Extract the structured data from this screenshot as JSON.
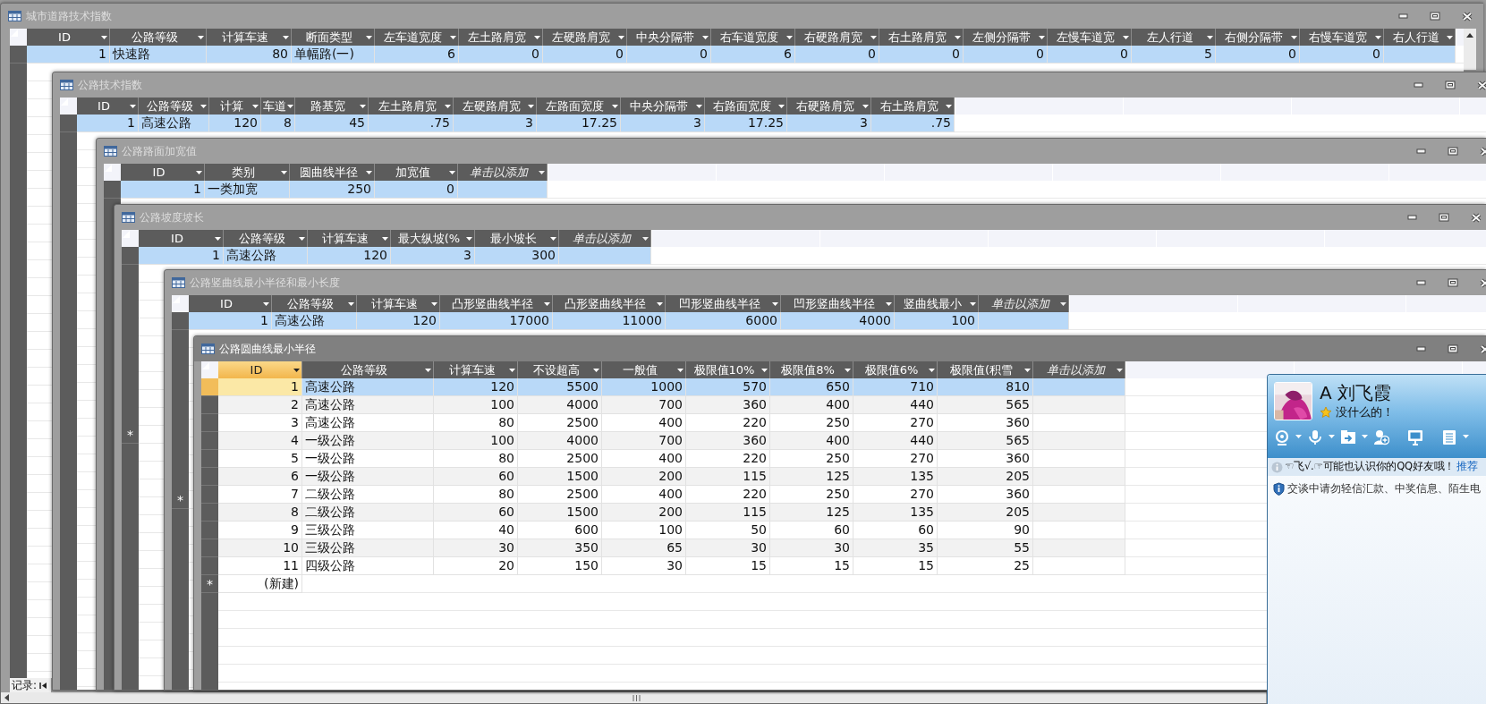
{
  "windows": [
    {
      "title": "城市道路技术指数",
      "active": false,
      "columns": [
        {
          "label": "ID",
          "kind": "number"
        },
        {
          "label": "公路等级",
          "kind": "text"
        },
        {
          "label": "计算车速",
          "kind": "number"
        },
        {
          "label": "断面类型",
          "kind": "text"
        },
        {
          "label": "左车道宽度",
          "kind": "number"
        },
        {
          "label": "左土路肩宽",
          "kind": "number"
        },
        {
          "label": "左硬路肩宽",
          "kind": "number"
        },
        {
          "label": "中央分隔带",
          "kind": "number"
        },
        {
          "label": "右车道宽度",
          "kind": "number"
        },
        {
          "label": "右硬路肩宽",
          "kind": "number"
        },
        {
          "label": "右土路肩宽",
          "kind": "number"
        },
        {
          "label": "左侧分隔带",
          "kind": "number"
        },
        {
          "label": "左慢车道宽",
          "kind": "number"
        },
        {
          "label": "左人行道",
          "kind": "number"
        },
        {
          "label": "右侧分隔带",
          "kind": "number"
        },
        {
          "label": "右慢车道宽",
          "kind": "number"
        },
        {
          "label": "右人行道",
          "kind": "number"
        }
      ],
      "rows": [
        {
          "cells": [
            "1",
            "快速路",
            "80",
            "单幅路(一)",
            "6",
            "0",
            "0",
            "0",
            "6",
            "0",
            "0",
            "0",
            "0",
            "5",
            "0",
            "0"
          ],
          "selected": true
        }
      ],
      "navigation": {
        "label": "记录:"
      }
    },
    {
      "title": "公路技术指数",
      "active": false,
      "columns": [
        {
          "label": "ID",
          "kind": "number"
        },
        {
          "label": "公路等级",
          "kind": "text"
        },
        {
          "label": "计算",
          "kind": "number"
        },
        {
          "label": "车道",
          "kind": "number"
        },
        {
          "label": "路基宽",
          "kind": "number"
        },
        {
          "label": "左土路肩宽",
          "kind": "number"
        },
        {
          "label": "左硬路肩宽",
          "kind": "number"
        },
        {
          "label": "左路面宽度",
          "kind": "number"
        },
        {
          "label": "中央分隔带",
          "kind": "number"
        },
        {
          "label": "右路面宽度",
          "kind": "number"
        },
        {
          "label": "右硬路肩宽",
          "kind": "number"
        },
        {
          "label": "右土路肩宽",
          "kind": "number"
        }
      ],
      "rows": [
        {
          "cells": [
            "1",
            "高速公路",
            "120",
            "8",
            "45",
            ".75",
            "3",
            "17.25",
            "3",
            "17.25",
            "3",
            ".75"
          ],
          "selected": true
        }
      ]
    },
    {
      "title": "公路路面加宽值",
      "active": false,
      "columns": [
        {
          "label": "ID",
          "kind": "number"
        },
        {
          "label": "类别",
          "kind": "text"
        },
        {
          "label": "圆曲线半径",
          "kind": "number"
        },
        {
          "label": "加宽值",
          "kind": "number"
        }
      ],
      "add_column": "单击以添加",
      "rows": [
        {
          "cells": [
            "1",
            "一类加宽",
            "250",
            "0"
          ],
          "selected": true
        }
      ]
    },
    {
      "title": "公路坡度坡长",
      "active": false,
      "columns": [
        {
          "label": "ID",
          "kind": "number"
        },
        {
          "label": "公路等级",
          "kind": "text"
        },
        {
          "label": "计算车速",
          "kind": "number"
        },
        {
          "label": "最大纵坡(%",
          "kind": "number"
        },
        {
          "label": "最小坡长",
          "kind": "number"
        }
      ],
      "add_column": "单击以添加",
      "rows": [
        {
          "cells": [
            "1",
            "高速公路",
            "120",
            "3",
            "300"
          ],
          "selected": true
        }
      ],
      "new_row": {
        "marker": "*"
      }
    },
    {
      "title": "公路竖曲线最小半径和最小长度",
      "active": false,
      "columns": [
        {
          "label": "ID",
          "kind": "number"
        },
        {
          "label": "公路等级",
          "kind": "text"
        },
        {
          "label": "计算车速",
          "kind": "number"
        },
        {
          "label": "凸形竖曲线半径",
          "kind": "number"
        },
        {
          "label": "凸形竖曲线半径",
          "kind": "number"
        },
        {
          "label": "凹形竖曲线半径",
          "kind": "number"
        },
        {
          "label": "凹形竖曲线半径",
          "kind": "number"
        },
        {
          "label": "竖曲线最小",
          "kind": "number"
        }
      ],
      "add_column": "单击以添加",
      "rows": [
        {
          "cells": [
            "1",
            "高速公路",
            "120",
            "17000",
            "11000",
            "6000",
            "4000",
            "100"
          ],
          "selected": true
        }
      ],
      "new_row": {
        "marker": "*"
      }
    },
    {
      "title": "公路圆曲线最小半径",
      "active": true,
      "columns": [
        {
          "label": "ID",
          "kind": "number",
          "selected": true
        },
        {
          "label": "公路等级",
          "kind": "text",
          "selected": false
        },
        {
          "label": "计算车速",
          "kind": "number",
          "selected": false
        },
        {
          "label": "不设超高",
          "kind": "number",
          "selected": false
        },
        {
          "label": "一般值",
          "kind": "number",
          "selected": false
        },
        {
          "label": "极限值10%",
          "kind": "number",
          "selected": false
        },
        {
          "label": "极限值8%",
          "kind": "number",
          "selected": false
        },
        {
          "label": "极限值6%",
          "kind": "number",
          "selected": false
        },
        {
          "label": "极限值(积雪",
          "kind": "number",
          "selected": false
        }
      ],
      "add_column": "单击以添加",
      "rows": [
        {
          "cells": [
            "1",
            "高速公路",
            "120",
            "5500",
            "1000",
            "570",
            "650",
            "710",
            "810"
          ],
          "selected": true
        },
        {
          "cells": [
            "2",
            "高速公路",
            "100",
            "4000",
            "700",
            "360",
            "400",
            "440",
            "565"
          ],
          "selected": false
        },
        {
          "cells": [
            "3",
            "高速公路",
            "80",
            "2500",
            "400",
            "220",
            "250",
            "270",
            "360"
          ],
          "selected": false
        },
        {
          "cells": [
            "4",
            "一级公路",
            "100",
            "4000",
            "700",
            "360",
            "400",
            "440",
            "565"
          ],
          "selected": false
        },
        {
          "cells": [
            "5",
            "一级公路",
            "80",
            "2500",
            "400",
            "220",
            "250",
            "270",
            "360"
          ],
          "selected": false
        },
        {
          "cells": [
            "6",
            "一级公路",
            "60",
            "1500",
            "200",
            "115",
            "125",
            "135",
            "205"
          ],
          "selected": false
        },
        {
          "cells": [
            "7",
            "二级公路",
            "80",
            "2500",
            "400",
            "220",
            "250",
            "270",
            "360"
          ],
          "selected": false
        },
        {
          "cells": [
            "8",
            "二级公路",
            "60",
            "1500",
            "200",
            "115",
            "125",
            "135",
            "205"
          ],
          "selected": false
        },
        {
          "cells": [
            "9",
            "三级公路",
            "40",
            "600",
            "100",
            "50",
            "60",
            "60",
            "90"
          ],
          "selected": false
        },
        {
          "cells": [
            "10",
            "三级公路",
            "30",
            "350",
            "65",
            "30",
            "30",
            "35",
            "55"
          ],
          "selected": false
        },
        {
          "cells": [
            "11",
            "四级公路",
            "20",
            "150",
            "30",
            "15",
            "15",
            "15",
            "25"
          ],
          "selected": false
        }
      ],
      "new_row": {
        "marker": "*",
        "label": "(新建)"
      }
    }
  ],
  "chat": {
    "name": "A 刘飞霞",
    "status": "没什么的！",
    "recommendation": "☜飞√.☞可能也认识你的QQ好友哦！",
    "recommend_link": "推荐",
    "notice": "交谈中请勿轻信汇款、中奖信息、陌生电"
  }
}
